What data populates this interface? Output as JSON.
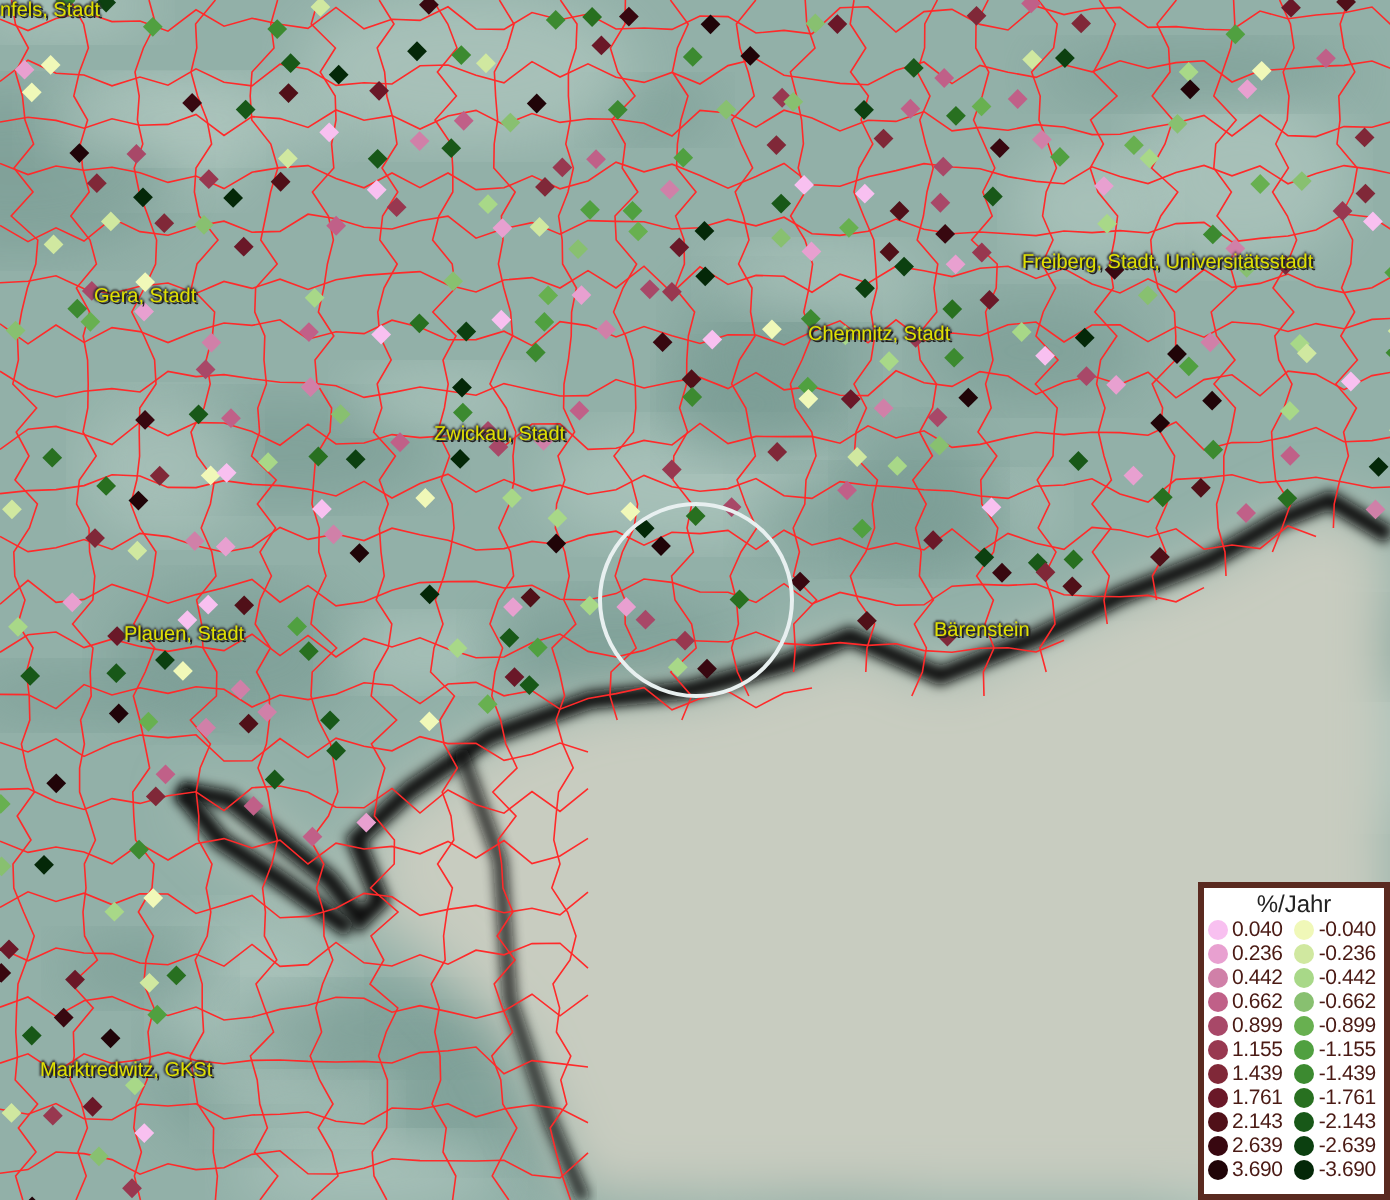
{
  "map": {
    "places": [
      {
        "name": "nfels, Stadt"
      },
      {
        "name": "Gera, Stadt"
      },
      {
        "name": "Freiberg, Stadt, Universitätsstadt"
      },
      {
        "name": "Chemnitz, Stadt"
      },
      {
        "name": "Zwickau, Stadt"
      },
      {
        "name": "Plauen, Stadt"
      },
      {
        "name": "Bärenstein"
      },
      {
        "name": "Marktredwitz, GKSt"
      }
    ]
  },
  "legend": {
    "title": "%/Jahr",
    "items": [
      {
        "label": "0.040",
        "color": "#f8c0f0"
      },
      {
        "label": "-0.040",
        "color": "#f0f8b8"
      },
      {
        "label": "0.236",
        "color": "#e8a0d0"
      },
      {
        "label": "-0.236",
        "color": "#d0e8a0"
      },
      {
        "label": "0.442",
        "color": "#d080a8"
      },
      {
        "label": "-0.442",
        "color": "#a8d888"
      },
      {
        "label": "0.662",
        "color": "#c06088"
      },
      {
        "label": "-0.662",
        "color": "#88c070"
      },
      {
        "label": "0.899",
        "color": "#a84868"
      },
      {
        "label": "-0.899",
        "color": "#68b050"
      },
      {
        "label": "1.155",
        "color": "#983850"
      },
      {
        "label": "-1.155",
        "color": "#50a040"
      },
      {
        "label": "1.439",
        "color": "#802838"
      },
      {
        "label": "-1.439",
        "color": "#3c8a30"
      },
      {
        "label": "1.761",
        "color": "#6a1828"
      },
      {
        "label": "-1.761",
        "color": "#287020"
      },
      {
        "label": "2.143",
        "color": "#501018"
      },
      {
        "label": "-2.143",
        "color": "#185818"
      },
      {
        "label": "2.639",
        "color": "#380810"
      },
      {
        "label": "-2.639",
        "color": "#0c4010"
      },
      {
        "label": "3.690",
        "color": "#200408"
      },
      {
        "label": "-3.690",
        "color": "#042808"
      }
    ]
  }
}
